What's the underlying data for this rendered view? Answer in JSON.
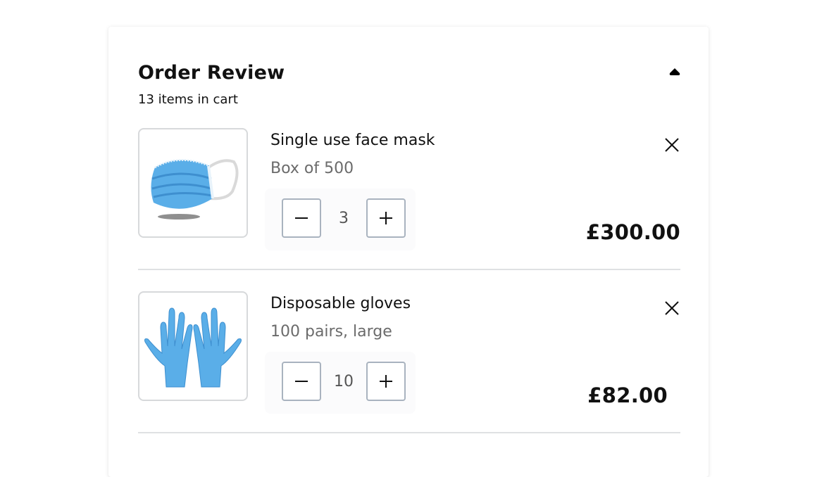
{
  "order": {
    "title": "Order Review",
    "item_count_text": "13 items in cart",
    "collapse_icon": "caret-up-icon"
  },
  "items": [
    {
      "name": "Single use face mask",
      "variant": "Box of 500",
      "quantity": "3",
      "price": "£300.00",
      "image": "face-mask-image"
    },
    {
      "name": "Disposable gloves",
      "variant": "100 pairs, large",
      "quantity": "10",
      "price": "£82.00",
      "image": "gloves-image"
    }
  ],
  "colors": {
    "product_blue": "#5aaee8",
    "border": "#d7d9db",
    "button_border": "#a9b3bf",
    "muted_text": "#6b6b6b"
  }
}
